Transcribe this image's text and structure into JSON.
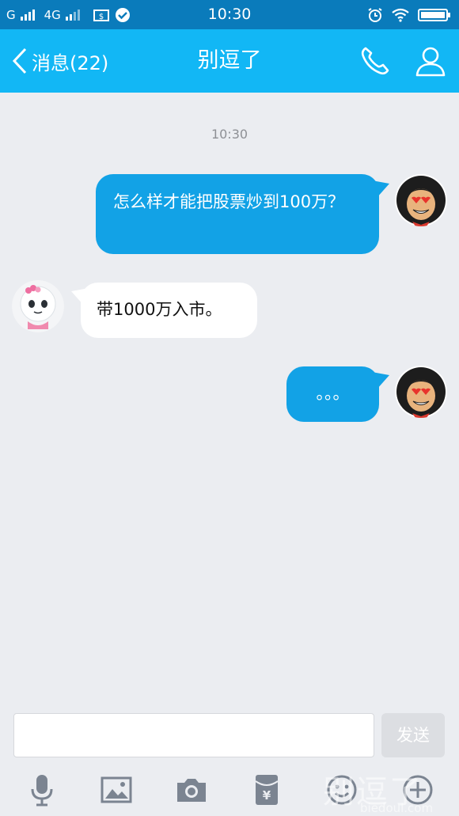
{
  "status_bar": {
    "carrier1": "G",
    "carrier2": "4G",
    "time": "10:30"
  },
  "header": {
    "back_label": "消息(22)",
    "title": "别逗了"
  },
  "chat": {
    "timestamp": "10:30",
    "messages": [
      {
        "direction": "out",
        "text": "怎么样才能把股票炒到100万？"
      },
      {
        "direction": "in",
        "text": "带1000万入市。"
      },
      {
        "direction": "out",
        "text": "。。。"
      }
    ]
  },
  "input": {
    "value": "",
    "send_label": "发送"
  },
  "toolbar": {
    "icons": [
      "microphone-icon",
      "image-icon",
      "camera-icon",
      "red-packet-icon",
      "emoji-icon",
      "plus-icon"
    ]
  },
  "watermark": {
    "text": "别逗了",
    "url": "biedoul.com"
  },
  "colors": {
    "status_bar": "#0a7bbb",
    "header": "#12b7f5",
    "bubble_out": "#12a2e6",
    "background": "#ebedf1"
  }
}
